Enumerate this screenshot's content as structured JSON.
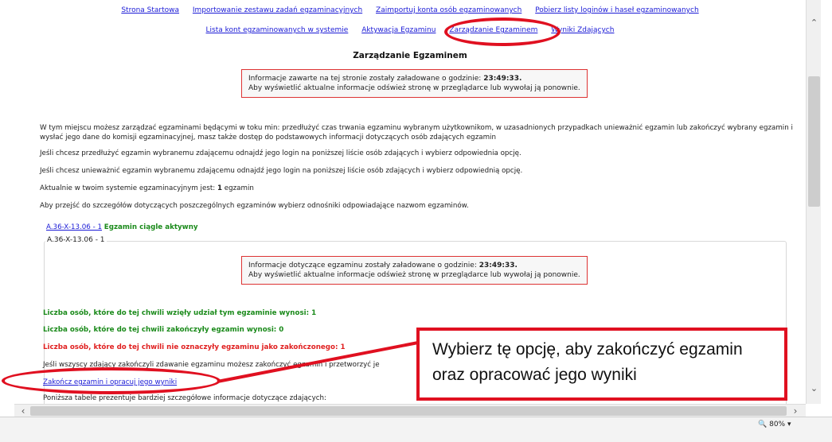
{
  "nav": {
    "row1": [
      "Strona Startowa",
      "Importowanie zestawu zadań egzaminacyjnych",
      "Zaimportuj konta osób egzaminowanych",
      "Pobierz listy loginów i haseł egzaminowanych"
    ],
    "row2": [
      "Lista kont egzaminowanych w systemie",
      "Aktywacja Egzaminu",
      "Zarządzanie Egzaminem",
      "Wyniki Zdających"
    ]
  },
  "page_title": "Zarządzanie Egzaminem",
  "info_top": {
    "line1_prefix": "Informacje zawarte na tej stronie zostały załadowane o godzinie:",
    "time": "23:49:33.",
    "line2": "Aby wyświetlić aktualne informacje odśwież stronę w przeglądarce lub wywołaj ją ponownie."
  },
  "paragraphs": {
    "intro": "W tym miejscu możesz zarządzać egzaminami będącymi w toku min: przedłużyć czas trwania egzaminu wybranym użytkownikom, w uzasadnionych przypadkach unieważnić egzamin lub zakończyć wybrany egzamin i wysłać jego dane do komisji egzaminacyjnej, masz także dostęp do podstawowych informacji dotyczących osób zdających egzamin",
    "extend": "Jeśli chcesz przedłużyć egzamin wybranemu zdającemu odnajdź jego login na poniższej liście osób zdających i wybierz odpowiednia opcję.",
    "cancel": "Jeśli chcesz unieważnić egzamin wybranemu zdającemu odnajdź jego login na poniższej liście osób zdających i wybierz odpowiednią opcję.",
    "current_prefix": "Aktualnie w twoim systemie egzaminacyjnym jest:",
    "current_count": "1",
    "current_suffix": "egzamin",
    "details": "Aby przejść do szczegółów dotyczących poszczególnych egzaminów wybierz odnośniki odpowiadające nazwom egzaminów."
  },
  "exam": {
    "link": "A.36-X-13.06 - 1",
    "status": "Egzamin ciągle aktywny",
    "panel_title": "A.36-X-13.06 - 1"
  },
  "info_exam": {
    "line1_prefix": "Informacje dotyczące egzaminu zostały załadowane o godzinie:",
    "time": "23:49:33.",
    "line2": "Aby wyświetlić aktualne informacje odśwież stronę w przeglądarce lub wywołaj ją ponownie."
  },
  "stats": {
    "participated": "Liczba osób, które do tej chwili wzięły udział tym egzaminie wynosi: 1",
    "finished": "Liczba osób, które do tej chwili zakończyły egzamin wynosi: 0",
    "not_marked": "Liczba osób, które do tej chwili nie oznaczyły egzaminu jako zakończonego: 1"
  },
  "finish_note": "Jeśli wszyscy zdający zakończyli zdawanie egzaminu możesz zakończyć egzamin i przetworzyć je",
  "finish_link": "Zakończ egzamin i opracuj jego wyniki",
  "table_note": "Poniższa tabele prezentuje bardziej szczegółowe informacje dotyczące zdających:",
  "callout": {
    "line1": "Wybierz tę opcję, aby zakończyć egzamin",
    "line2": "oraz opracować jego wyniki"
  },
  "zoom": "80%",
  "colors": {
    "annotation": "#e01020",
    "link": "#1a1ad6",
    "green": "#1a8a1a",
    "red": "#e02020"
  }
}
